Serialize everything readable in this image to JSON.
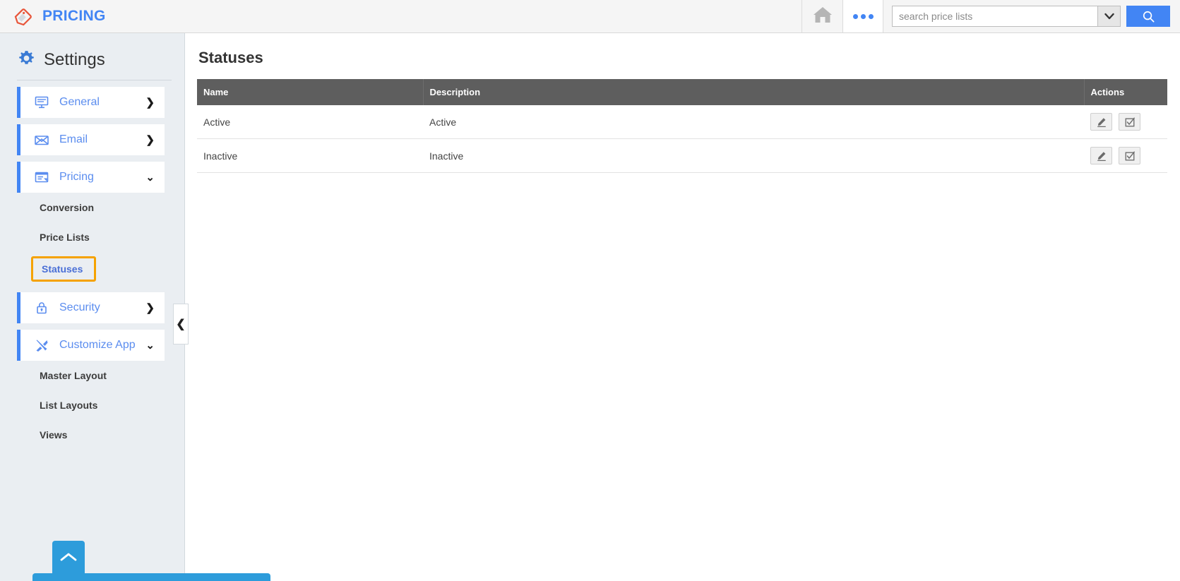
{
  "app": {
    "brand_title": "PRICING",
    "brand_icon": "price-tag-icon"
  },
  "topbar": {
    "home_icon": "home-icon",
    "overflow_icon": "ellipsis-icon",
    "search": {
      "placeholder": "search price lists",
      "value": "",
      "dropdown_icon": "chevron-down-icon",
      "submit_icon": "search-icon"
    }
  },
  "sidebar": {
    "heading": "Settings",
    "heading_icon": "gear-icon",
    "collapse_icon": "chevron-left-icon",
    "scroll_top_icon": "chevron-up-icon",
    "groups": [
      {
        "label": "General",
        "icon": "monitor-icon",
        "chevron": "❯",
        "expanded": false,
        "children": []
      },
      {
        "label": "Email",
        "icon": "envelope-icon",
        "chevron": "❯",
        "expanded": false,
        "children": []
      },
      {
        "label": "Pricing",
        "icon": "price-list-icon",
        "chevron": "⌄",
        "expanded": true,
        "children": [
          {
            "label": "Conversion",
            "selected": false
          },
          {
            "label": "Price Lists",
            "selected": false
          },
          {
            "label": "Statuses",
            "selected": true
          }
        ]
      },
      {
        "label": "Security",
        "icon": "lock-icon",
        "chevron": "❯",
        "expanded": false,
        "children": []
      },
      {
        "label": "Customize App",
        "icon": "tools-icon",
        "chevron": "⌄",
        "expanded": true,
        "children": [
          {
            "label": "Master Layout",
            "selected": false
          },
          {
            "label": "List Layouts",
            "selected": false
          },
          {
            "label": "Views",
            "selected": false
          }
        ]
      }
    ]
  },
  "main": {
    "page_title": "Statuses",
    "table": {
      "columns": [
        "Name",
        "Description",
        "Actions"
      ],
      "rows": [
        {
          "name": "Active",
          "description": "Active"
        },
        {
          "name": "Inactive",
          "description": "Inactive"
        }
      ],
      "row_actions": [
        {
          "name": "edit-button",
          "icon": "pencil-icon"
        },
        {
          "name": "select-button",
          "icon": "checkbox-check-icon"
        }
      ]
    }
  },
  "colors": {
    "brand_blue": "#4285f4",
    "link_blue": "#5b8def",
    "accent_orange": "#f5a200",
    "table_header_gray": "#5e5e5e",
    "sidebar_bg": "#eaeef2",
    "bottom_bar_blue": "#2d9cdb"
  }
}
